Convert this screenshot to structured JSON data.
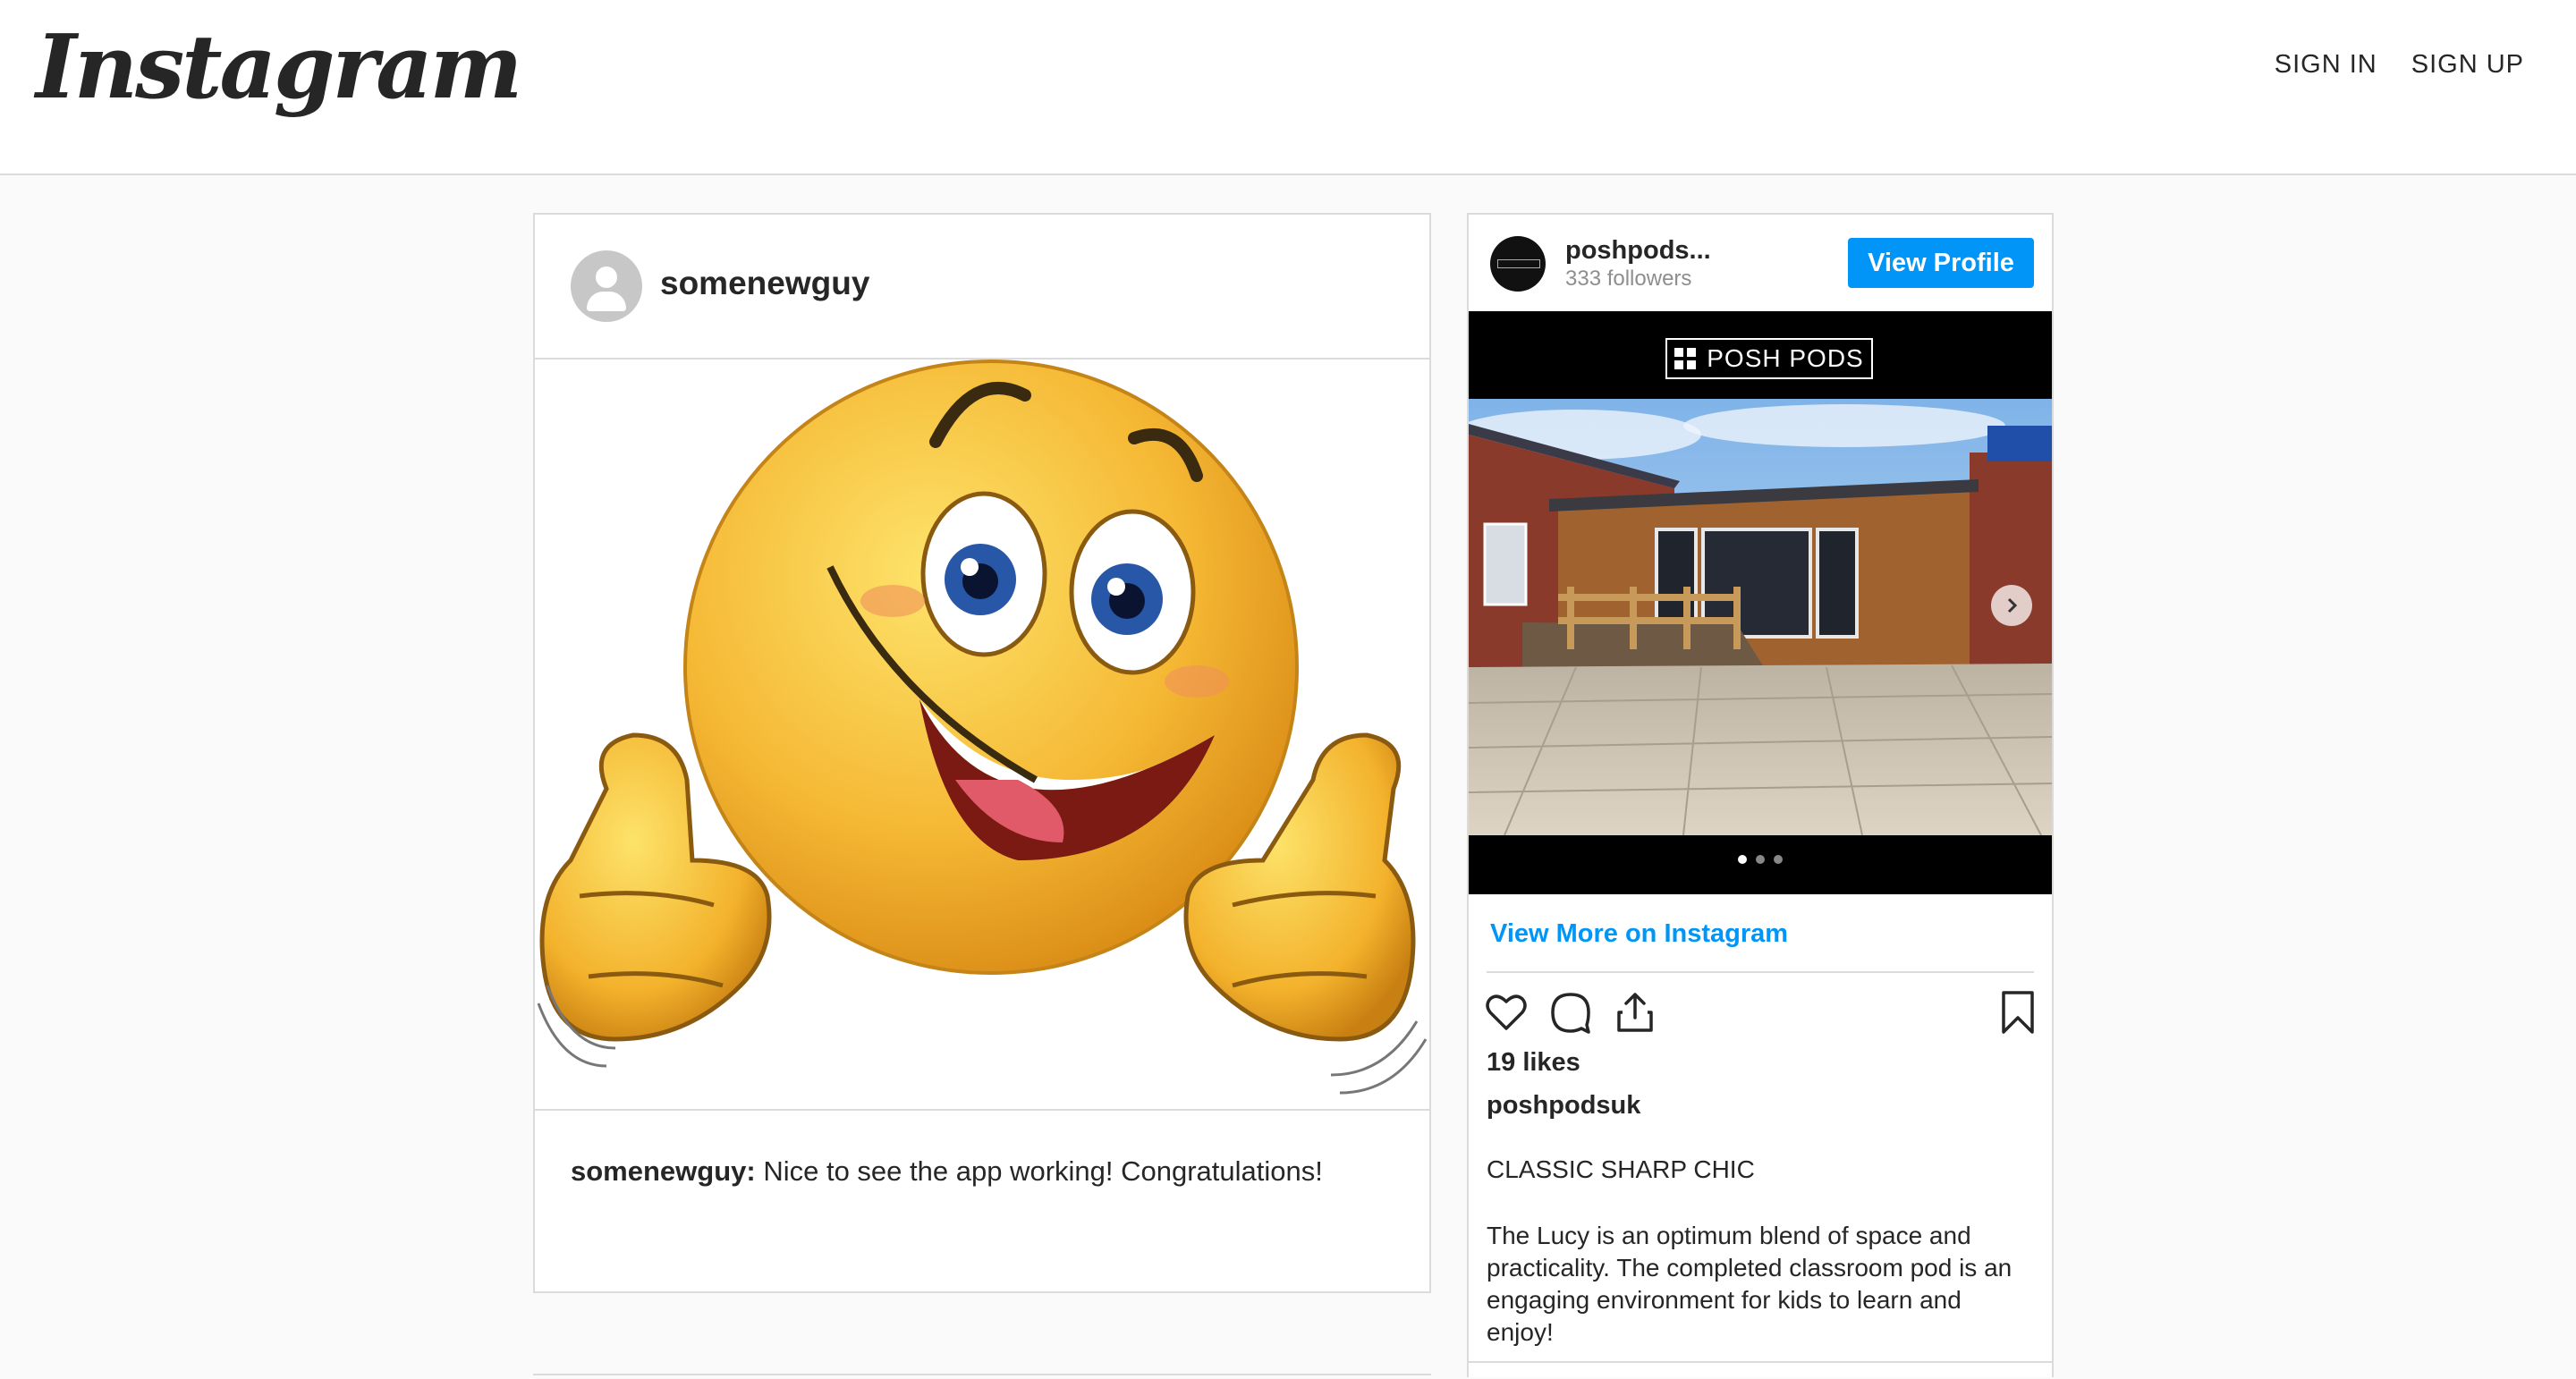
{
  "header": {
    "logo_text": "Instagram",
    "sign_in": "SIGN IN",
    "sign_up": "SIGN UP"
  },
  "post": {
    "username": "somenewguy",
    "image_icon": "thumbs-up-smiley-emoji",
    "caption_user": "somenewguy:",
    "caption_text": " Nice to see the app working! Congratulations!"
  },
  "embed": {
    "account_name": "poshpods...",
    "followers": "333 followers",
    "view_profile": "View Profile",
    "brand_text": "POSH PODS",
    "carousel_dots": 3,
    "carousel_active": 0,
    "view_more": "View More on Instagram",
    "likes": "19 likes",
    "username": "poshpodsuk",
    "title": "CLASSIC SHARP CHIC",
    "body": "The Lucy is an optimum blend of space and practicality. The completed classroom pod is an engaging environment for kids to learn and enjoy!",
    "icons": [
      "heart-icon",
      "comment-icon",
      "share-icon",
      "bookmark-icon"
    ]
  },
  "colors": {
    "accent": "#0095f6",
    "border": "#dbdbdb",
    "background": "#fafafa",
    "text": "#262626",
    "muted": "#8e8e8e"
  }
}
